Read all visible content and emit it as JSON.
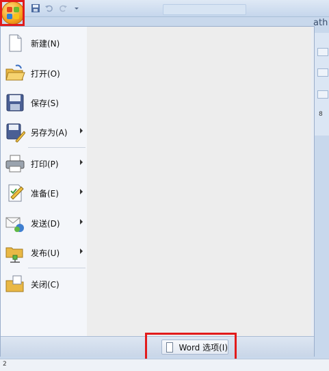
{
  "menu": {
    "items": [
      {
        "label": "新建(N)",
        "icon": "new-document-icon",
        "has_submenu": false
      },
      {
        "label": "打开(O)",
        "icon": "open-folder-icon",
        "has_submenu": false
      },
      {
        "label": "保存(S)",
        "icon": "save-disk-icon",
        "has_submenu": false
      },
      {
        "label": "另存为(A)",
        "icon": "save-as-icon",
        "has_submenu": true
      },
      {
        "label": "打印(P)",
        "icon": "printer-icon",
        "has_submenu": true
      },
      {
        "label": "准备(E)",
        "icon": "prepare-icon",
        "has_submenu": true
      },
      {
        "label": "发送(D)",
        "icon": "send-icon",
        "has_submenu": true
      },
      {
        "label": "发布(U)",
        "icon": "publish-icon",
        "has_submenu": true
      },
      {
        "label": "关闭(C)",
        "icon": "close-folder-icon",
        "has_submenu": false
      }
    ],
    "options_button": "Word 选项(I)"
  },
  "window": {
    "title_fragment": "ath",
    "ruler_number": "8",
    "page_number": "2"
  },
  "colors": {
    "highlight": "#e21b1b",
    "office_button": "#f6a21e"
  }
}
